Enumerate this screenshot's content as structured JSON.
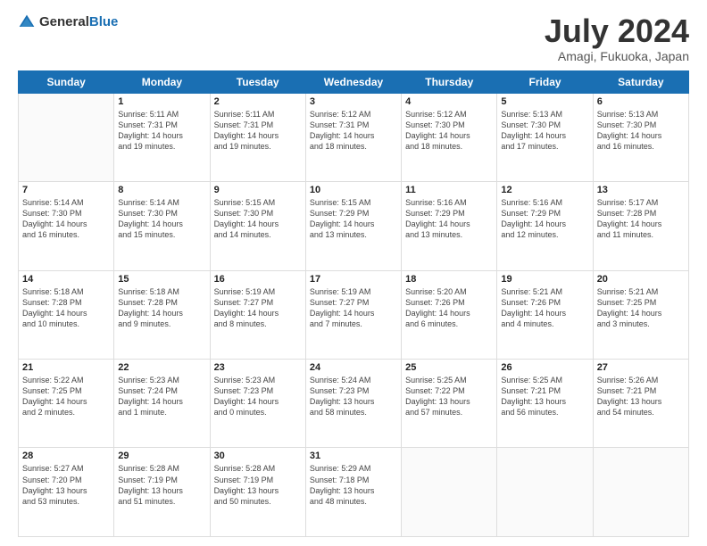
{
  "logo": {
    "general": "General",
    "blue": "Blue"
  },
  "title": {
    "month_year": "July 2024",
    "location": "Amagi, Fukuoka, Japan"
  },
  "days_of_week": [
    "Sunday",
    "Monday",
    "Tuesday",
    "Wednesday",
    "Thursday",
    "Friday",
    "Saturday"
  ],
  "weeks": [
    [
      {
        "day": "",
        "info": ""
      },
      {
        "day": "1",
        "info": "Sunrise: 5:11 AM\nSunset: 7:31 PM\nDaylight: 14 hours\nand 19 minutes."
      },
      {
        "day": "2",
        "info": "Sunrise: 5:11 AM\nSunset: 7:31 PM\nDaylight: 14 hours\nand 19 minutes."
      },
      {
        "day": "3",
        "info": "Sunrise: 5:12 AM\nSunset: 7:31 PM\nDaylight: 14 hours\nand 18 minutes."
      },
      {
        "day": "4",
        "info": "Sunrise: 5:12 AM\nSunset: 7:30 PM\nDaylight: 14 hours\nand 18 minutes."
      },
      {
        "day": "5",
        "info": "Sunrise: 5:13 AM\nSunset: 7:30 PM\nDaylight: 14 hours\nand 17 minutes."
      },
      {
        "day": "6",
        "info": "Sunrise: 5:13 AM\nSunset: 7:30 PM\nDaylight: 14 hours\nand 16 minutes."
      }
    ],
    [
      {
        "day": "7",
        "info": "Sunrise: 5:14 AM\nSunset: 7:30 PM\nDaylight: 14 hours\nand 16 minutes."
      },
      {
        "day": "8",
        "info": "Sunrise: 5:14 AM\nSunset: 7:30 PM\nDaylight: 14 hours\nand 15 minutes."
      },
      {
        "day": "9",
        "info": "Sunrise: 5:15 AM\nSunset: 7:30 PM\nDaylight: 14 hours\nand 14 minutes."
      },
      {
        "day": "10",
        "info": "Sunrise: 5:15 AM\nSunset: 7:29 PM\nDaylight: 14 hours\nand 13 minutes."
      },
      {
        "day": "11",
        "info": "Sunrise: 5:16 AM\nSunset: 7:29 PM\nDaylight: 14 hours\nand 13 minutes."
      },
      {
        "day": "12",
        "info": "Sunrise: 5:16 AM\nSunset: 7:29 PM\nDaylight: 14 hours\nand 12 minutes."
      },
      {
        "day": "13",
        "info": "Sunrise: 5:17 AM\nSunset: 7:28 PM\nDaylight: 14 hours\nand 11 minutes."
      }
    ],
    [
      {
        "day": "14",
        "info": "Sunrise: 5:18 AM\nSunset: 7:28 PM\nDaylight: 14 hours\nand 10 minutes."
      },
      {
        "day": "15",
        "info": "Sunrise: 5:18 AM\nSunset: 7:28 PM\nDaylight: 14 hours\nand 9 minutes."
      },
      {
        "day": "16",
        "info": "Sunrise: 5:19 AM\nSunset: 7:27 PM\nDaylight: 14 hours\nand 8 minutes."
      },
      {
        "day": "17",
        "info": "Sunrise: 5:19 AM\nSunset: 7:27 PM\nDaylight: 14 hours\nand 7 minutes."
      },
      {
        "day": "18",
        "info": "Sunrise: 5:20 AM\nSunset: 7:26 PM\nDaylight: 14 hours\nand 6 minutes."
      },
      {
        "day": "19",
        "info": "Sunrise: 5:21 AM\nSunset: 7:26 PM\nDaylight: 14 hours\nand 4 minutes."
      },
      {
        "day": "20",
        "info": "Sunrise: 5:21 AM\nSunset: 7:25 PM\nDaylight: 14 hours\nand 3 minutes."
      }
    ],
    [
      {
        "day": "21",
        "info": "Sunrise: 5:22 AM\nSunset: 7:25 PM\nDaylight: 14 hours\nand 2 minutes."
      },
      {
        "day": "22",
        "info": "Sunrise: 5:23 AM\nSunset: 7:24 PM\nDaylight: 14 hours\nand 1 minute."
      },
      {
        "day": "23",
        "info": "Sunrise: 5:23 AM\nSunset: 7:23 PM\nDaylight: 14 hours\nand 0 minutes."
      },
      {
        "day": "24",
        "info": "Sunrise: 5:24 AM\nSunset: 7:23 PM\nDaylight: 13 hours\nand 58 minutes."
      },
      {
        "day": "25",
        "info": "Sunrise: 5:25 AM\nSunset: 7:22 PM\nDaylight: 13 hours\nand 57 minutes."
      },
      {
        "day": "26",
        "info": "Sunrise: 5:25 AM\nSunset: 7:21 PM\nDaylight: 13 hours\nand 56 minutes."
      },
      {
        "day": "27",
        "info": "Sunrise: 5:26 AM\nSunset: 7:21 PM\nDaylight: 13 hours\nand 54 minutes."
      }
    ],
    [
      {
        "day": "28",
        "info": "Sunrise: 5:27 AM\nSunset: 7:20 PM\nDaylight: 13 hours\nand 53 minutes."
      },
      {
        "day": "29",
        "info": "Sunrise: 5:28 AM\nSunset: 7:19 PM\nDaylight: 13 hours\nand 51 minutes."
      },
      {
        "day": "30",
        "info": "Sunrise: 5:28 AM\nSunset: 7:19 PM\nDaylight: 13 hours\nand 50 minutes."
      },
      {
        "day": "31",
        "info": "Sunrise: 5:29 AM\nSunset: 7:18 PM\nDaylight: 13 hours\nand 48 minutes."
      },
      {
        "day": "",
        "info": ""
      },
      {
        "day": "",
        "info": ""
      },
      {
        "day": "",
        "info": ""
      }
    ]
  ]
}
